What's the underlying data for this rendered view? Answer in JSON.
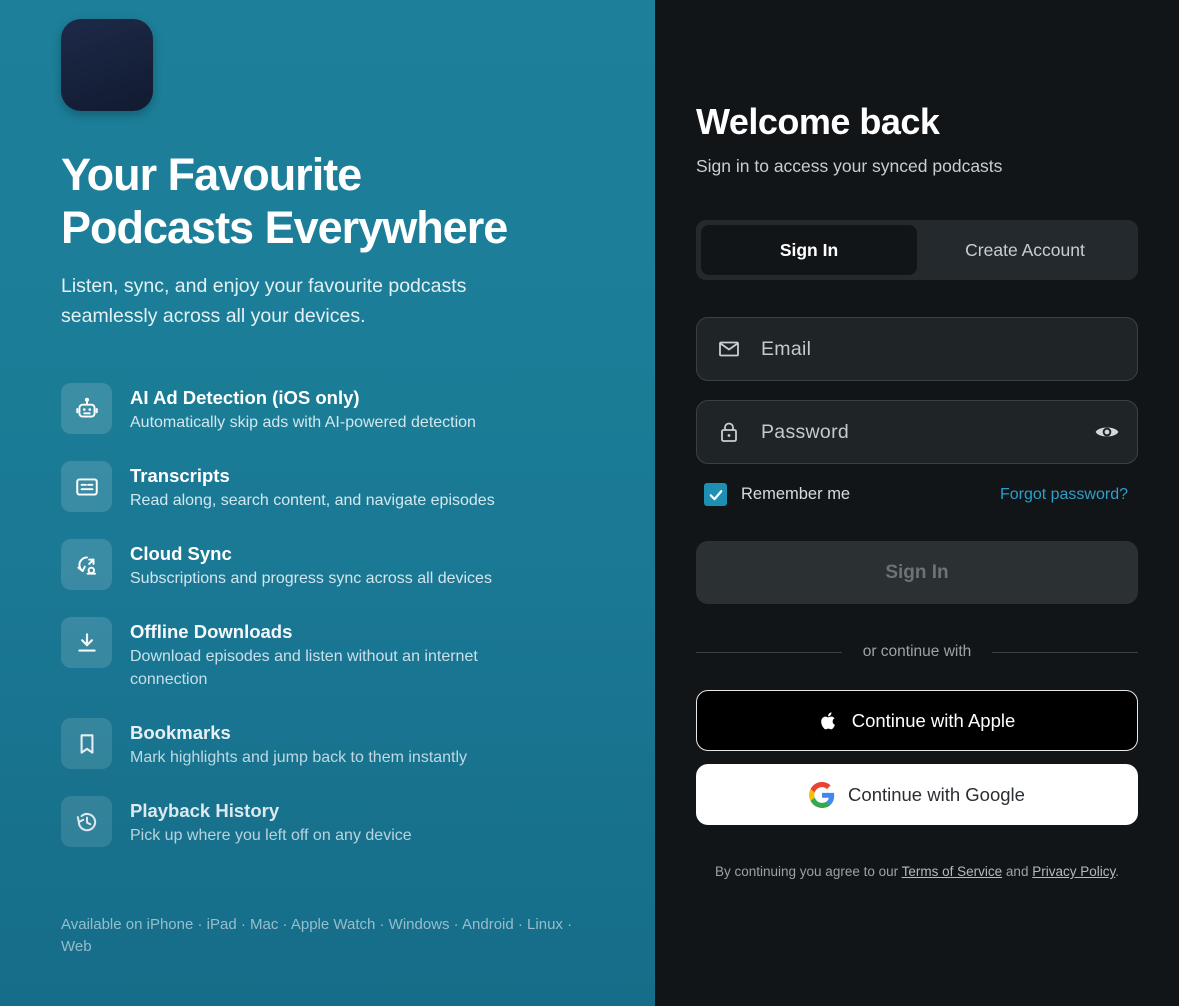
{
  "left": {
    "logo_icon": "waveform-icon",
    "title_line1": "Your Favourite",
    "title_line2": "Podcasts Everywhere",
    "subtitle": "Listen, sync, and enjoy your favourite podcasts seamlessly across all your devices.",
    "features": [
      {
        "icon": "robot-icon",
        "title": "AI Ad Detection (iOS only)",
        "desc": "Automatically skip ads with AI-powered detection"
      },
      {
        "icon": "transcript-icon",
        "title": "Transcripts",
        "desc": "Read along, search content, and navigate episodes"
      },
      {
        "icon": "sync-icon",
        "title": "Cloud Sync",
        "desc": "Subscriptions and progress sync across all devices"
      },
      {
        "icon": "download-icon",
        "title": "Offline Downloads",
        "desc": "Download episodes and listen without an internet connection"
      },
      {
        "icon": "bookmark-icon",
        "title": "Bookmarks",
        "desc": "Mark highlights and jump back to them instantly"
      },
      {
        "icon": "history-icon",
        "title": "Playback History",
        "desc": "Pick up where you left off on any device"
      }
    ],
    "platforms": "Available on iPhone · iPad · Mac · Apple Watch · Windows · Android · Linux · Web"
  },
  "right": {
    "welcome": "Welcome back",
    "welcome_sub": "Sign in to access your synced podcasts",
    "tabs": {
      "signin": "Sign In",
      "create": "Create Account"
    },
    "email_placeholder": "Email",
    "password_placeholder": "Password",
    "remember": "Remember me",
    "remember_checked": true,
    "forgot": "Forgot password?",
    "signin_button": "Sign In",
    "divider": "or continue with",
    "apple": "Continue with Apple",
    "google": "Continue with Google",
    "legal_prefix": "By continuing you agree to our",
    "terms": "Terms of Service",
    "legal_and": "and",
    "privacy": "Privacy Policy",
    "legal_suffix": "."
  },
  "colors": {
    "left_bg": "#1b7d97",
    "right_bg": "#121518",
    "accent": "#1e8fb3",
    "link": "#2d9fc8"
  }
}
